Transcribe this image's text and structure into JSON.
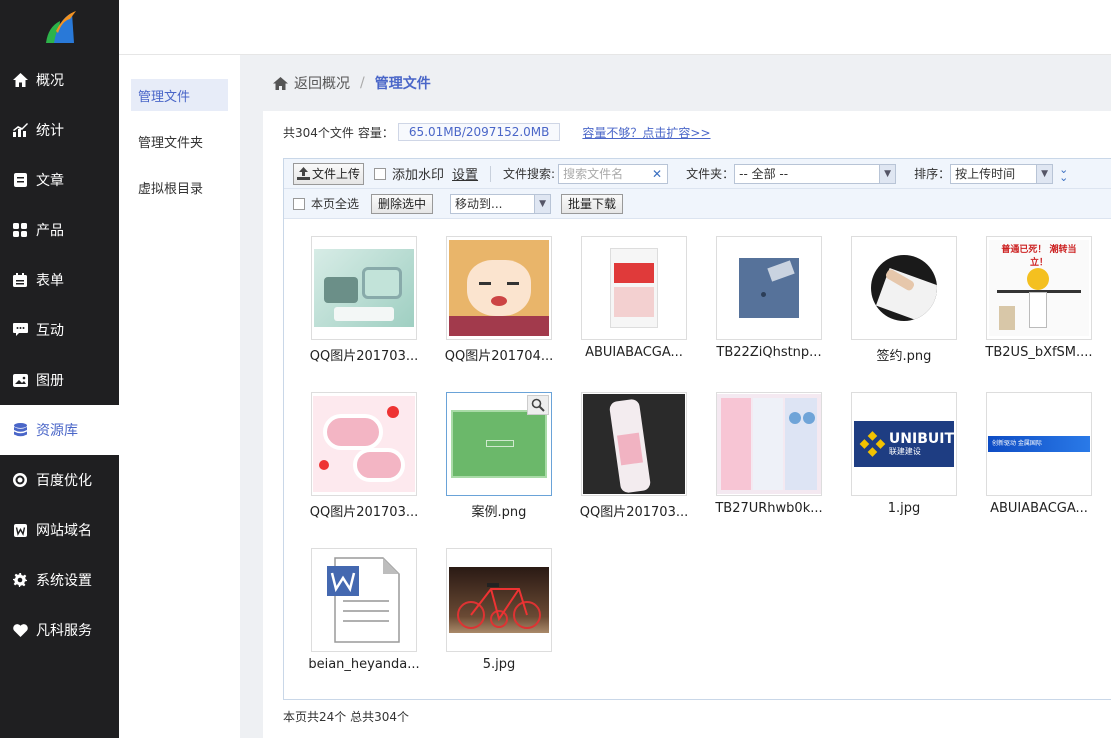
{
  "nav": {
    "items": [
      {
        "label": "概况",
        "icon": "home-icon"
      },
      {
        "label": "统计",
        "icon": "chart-icon"
      },
      {
        "label": "文章",
        "icon": "article-icon"
      },
      {
        "label": "产品",
        "icon": "grid-icon"
      },
      {
        "label": "表单",
        "icon": "calendar-icon"
      },
      {
        "label": "互动",
        "icon": "chat-icon"
      },
      {
        "label": "图册",
        "icon": "album-icon"
      },
      {
        "label": "资源库",
        "icon": "database-icon",
        "active": true
      },
      {
        "label": "百度优化",
        "icon": "target-icon"
      },
      {
        "label": "网站域名",
        "icon": "w-icon"
      },
      {
        "label": "系统设置",
        "icon": "gear-icon"
      },
      {
        "label": "凡科服务",
        "icon": "heart-icon"
      }
    ]
  },
  "subnav": {
    "items": [
      "管理文件",
      "管理文件夹",
      "虚拟根目录"
    ]
  },
  "breadcrumb": {
    "back": "返回概况",
    "sep": "/",
    "current": "管理文件"
  },
  "info": {
    "total": "共304个文件",
    "capacity_label": "容量：",
    "capacity_value": "65.01MB/2097152.0MB",
    "expand_link": "容量不够？点击扩容>>"
  },
  "toolbar": {
    "upload": "文件上传",
    "watermark": "添加水印",
    "settings": "设置",
    "search_label": "文件搜索:",
    "search_placeholder": "搜索文件名",
    "folder_label": "文件夹：",
    "folder_value": "-- 全部 --",
    "sort_label": "排序：",
    "sort_value": "按上传时间",
    "select_all": "本页全选",
    "delete": "删除选中",
    "move_to": "移动到...",
    "batch_download": "批量下载"
  },
  "files": [
    {
      "name": "QQ图片201703..."
    },
    {
      "name": "QQ图片201704..."
    },
    {
      "name": "ABUIABACGA..."
    },
    {
      "name": "TB22ZiQhstnp..."
    },
    {
      "name": "签约.png"
    },
    {
      "name": "TB2US_bXfSM...."
    },
    {
      "name": "QQ图片201703..."
    },
    {
      "name": "案例.png"
    },
    {
      "name": "QQ图片201703..."
    },
    {
      "name": "TB27URhwb0k..."
    },
    {
      "name": "1.jpg"
    },
    {
      "name": "ABUIABACGA..."
    },
    {
      "name": "beian_heyanda..."
    },
    {
      "name": "5.jpg"
    }
  ],
  "thumb_text": {
    "unibuilt": "UNIBUIT",
    "unibuilt_sub": "联建建设",
    "banner": "创新驱动 金属国际",
    "tb2us_title": "普通已死！ 潮转当立！"
  },
  "footer": "本页共24个 总共304个"
}
